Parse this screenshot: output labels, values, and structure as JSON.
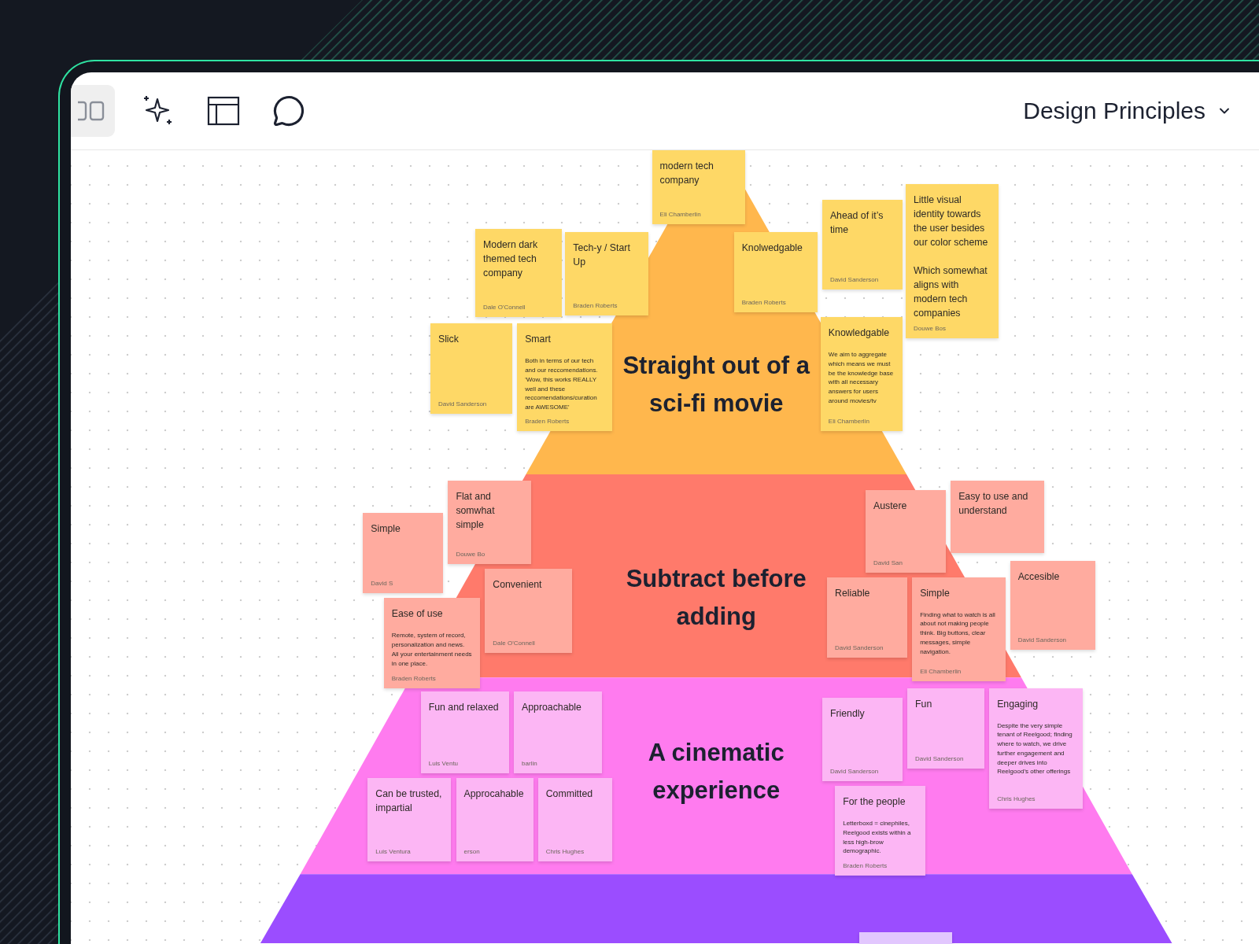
{
  "toolbar": {
    "tools": [
      {
        "kind": "grid",
        "selected": true
      },
      {
        "kind": "sparkle",
        "selected": false
      },
      {
        "kind": "layout",
        "selected": false
      },
      {
        "kind": "comment",
        "selected": false
      }
    ],
    "board_title": "Design Principles"
  },
  "pyramid": {
    "layers": [
      {
        "title": "Straight out of a sci-fi movie",
        "color": "#ffb74d"
      },
      {
        "title": "Subtract before adding",
        "color": "#ff7a6b"
      },
      {
        "title": "A cinematic experience",
        "color": "#ff7bef"
      },
      {
        "color": "#9b4dff"
      }
    ]
  },
  "notes": [
    {
      "title": "modern tech company",
      "author": "Eli Chamberlin",
      "color": "#fed866"
    },
    {
      "title": "Modern dark themed tech company",
      "author": "Dale O'Connell",
      "color": "#fed866"
    },
    {
      "title": "Tech-y / Start Up",
      "author": "Braden Roberts",
      "color": "#fed866"
    },
    {
      "title": "Slick",
      "author": "David Sanderson",
      "color": "#fed866"
    },
    {
      "title": "Smart",
      "body": "Both in terms of our tech and our reccomendations. 'Wow, this works REALLY well and these reccomendations/curation are AWESOME'",
      "author": "Braden Roberts",
      "color": "#fed866"
    },
    {
      "title": "Knolwedgable",
      "author": "Braden Roberts",
      "color": "#fed866"
    },
    {
      "title": "Ahead of it’s time",
      "author": "David Sanderson",
      "color": "#fed866"
    },
    {
      "title": "Knowledgable",
      "body": "We aim to aggregate which means we must be the knowledge base with all necessary answers for users around movies/tv",
      "author": "Eli Chamberlin",
      "color": "#fed866"
    },
    {
      "title": "Little visual identity towards the user besides our color scheme\n\nWhich somewhat aligns with modern tech companies",
      "author": "Douwe Bos",
      "color": "#fed866"
    },
    {
      "title": "Simple",
      "author": "David S",
      "color": "#ffab9f"
    },
    {
      "title": "Ease of use",
      "body": "Remote, system of record, personalization and news. All your entertainment needs in one place.",
      "author": "Braden Roberts",
      "color": "#ffab9f"
    },
    {
      "title": "Flat and somwhat simple",
      "author": "Douwe Bo",
      "color": "#ffab9f"
    },
    {
      "title": "Convenient",
      "author": "Dale O'Connell",
      "color": "#ffab9f"
    },
    {
      "title": "Reliable",
      "author": "David Sanderson",
      "color": "#ffab9f"
    },
    {
      "title": "Austere",
      "author": "David San",
      "color": "#ffab9f"
    },
    {
      "title": "Easy to use and understand",
      "color": "#ffab9f"
    },
    {
      "title": "Accesible",
      "author": "David Sanderson",
      "color": "#ffab9f"
    },
    {
      "title": "Simple",
      "body": "Finding what to watch is all about not making people think. Big buttons, clear messages, simple navigation.",
      "author": "Eli Chamberlin",
      "color": "#ffab9f"
    },
    {
      "title": "Fun and relaxed",
      "author": "Luis Ventu",
      "color": "#fcb6f4"
    },
    {
      "title": "Approachable",
      "author": "barlin",
      "color": "#fcb6f4"
    },
    {
      "title": "Can be trusted, impartial",
      "author": "Luis Ventura",
      "color": "#fcb6f4"
    },
    {
      "title": "Approcahable",
      "author": "erson",
      "color": "#fcb6f4"
    },
    {
      "title": "Committed",
      "author": "Chris Hughes",
      "color": "#fcb6f4"
    },
    {
      "title": "Friendly",
      "author": "David Sanderson",
      "color": "#fcb6f4"
    },
    {
      "title": "Fun",
      "author": "David Sanderson",
      "color": "#fcb6f4"
    },
    {
      "title": "For the people",
      "body": "Letterboxd = cinephiles, Reelgood exists within a less high-brow demographic.",
      "author": "Braden Roberts",
      "color": "#fcb6f4"
    },
    {
      "title": "Engaging",
      "body": "Despite the very simple tenant of Reelgood; finding where to watch, we drive further engagement and deeper drives into Reelgood’s other offerings",
      "author": "Chris Hughes",
      "color": "#fcb6f4"
    },
    {
      "color": "#e2c7fe"
    }
  ]
}
